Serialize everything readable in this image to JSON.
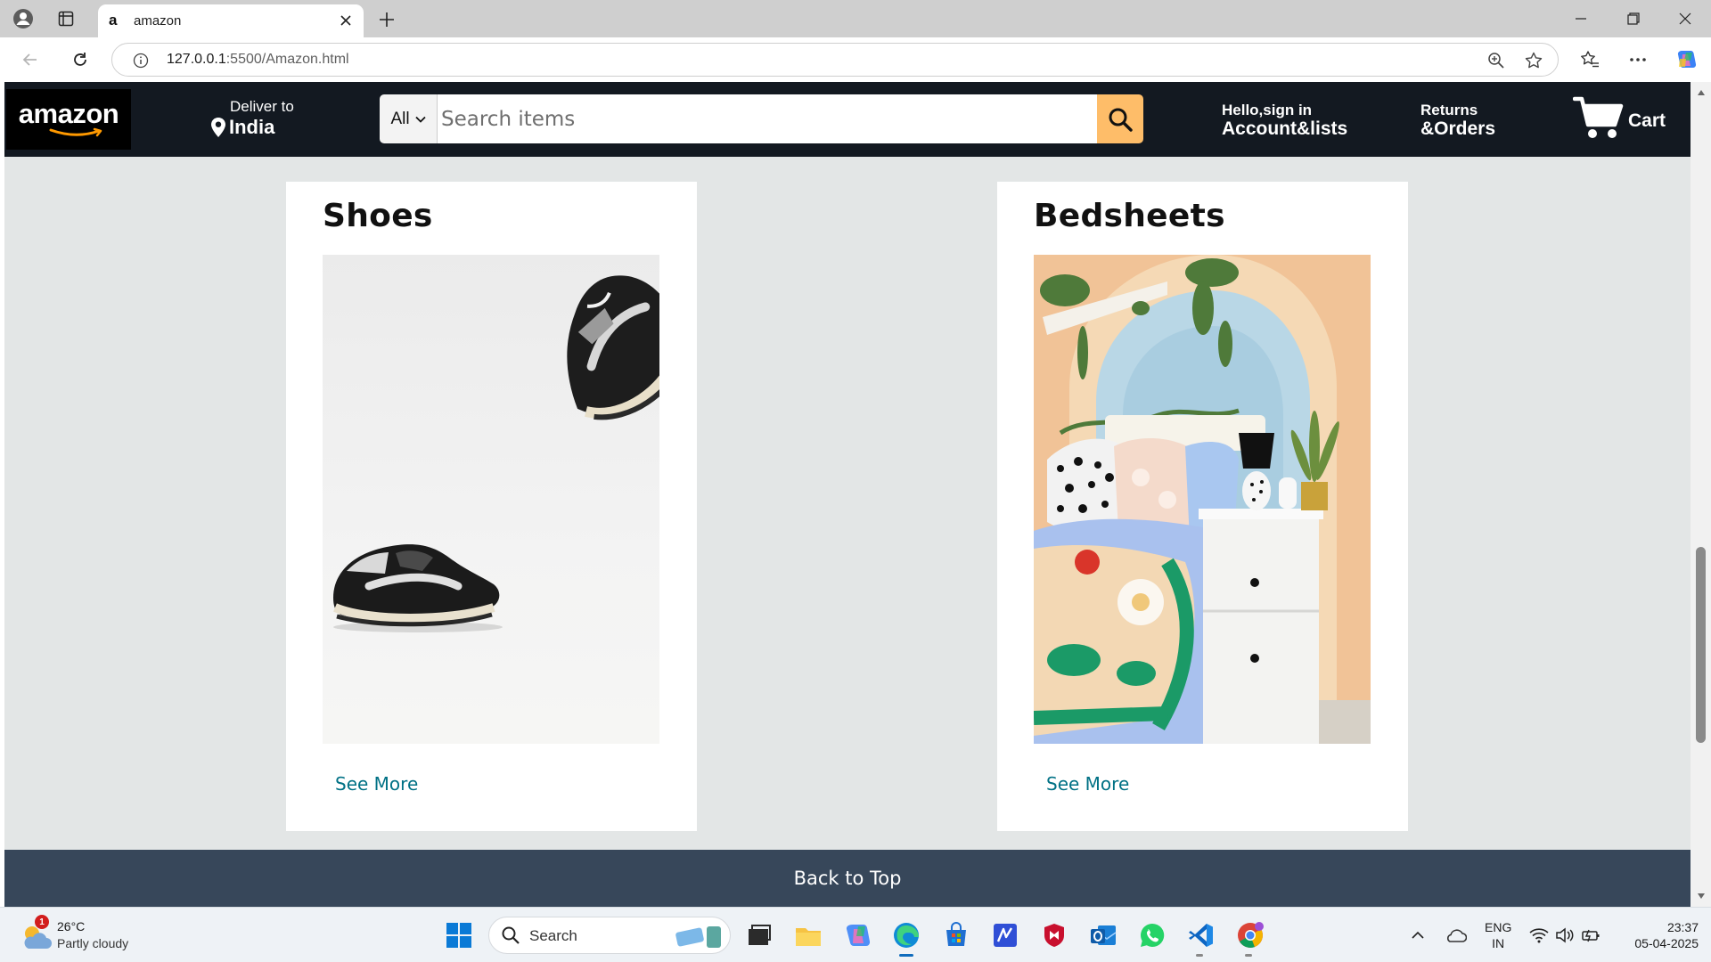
{
  "browser": {
    "tab_title": "amazon",
    "tab_favicon": "a",
    "url_host": "127.0.0.1",
    "url_rest": ":5500/Amazon.html"
  },
  "header": {
    "logo": "amazon",
    "deliver_label": "Deliver to",
    "deliver_location": "India",
    "search_category": "All",
    "search_placeholder": "Search items",
    "account_line1": "Hello,sign in",
    "account_line2": "Account&lists",
    "returns_line1": "Returns",
    "returns_line2": "&Orders",
    "cart_label": "Cart"
  },
  "cards": [
    {
      "title": "Shoes",
      "link": "See More"
    },
    {
      "title": "Bedsheets",
      "link": "See More"
    }
  ],
  "footer": {
    "back_to_top": "Back to Top"
  },
  "taskbar": {
    "weather_temp": "26°C",
    "weather_desc": "Partly cloudy",
    "weather_badge": "1",
    "search_label": "Search",
    "lang_line1": "ENG",
    "lang_line2": "IN",
    "time": "23:37",
    "date": "05-04-2025"
  },
  "colors": {
    "header_bg": "#131921",
    "search_button": "#febd69",
    "link": "#007185",
    "back_to_top_bg": "#37475a",
    "page_bg": "#e3e6e6"
  }
}
